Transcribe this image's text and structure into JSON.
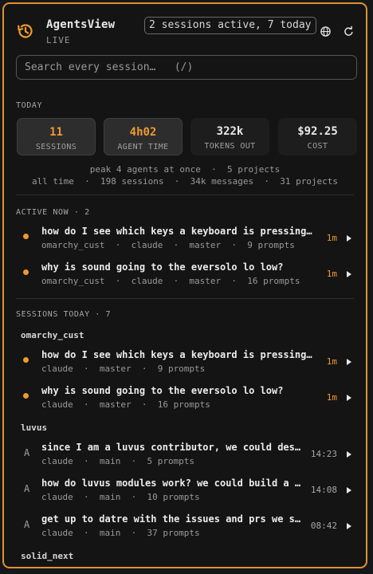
{
  "header": {
    "title": "AgentsView",
    "status": "LIVE",
    "sessions_pill": "2 sessions active, 7 today"
  },
  "search": {
    "placeholder": "Search every session…   (/)"
  },
  "today": {
    "label": "TODAY",
    "stats": [
      {
        "value": "11",
        "label": "SESSIONS"
      },
      {
        "value": "4h02",
        "label": "AGENT TIME"
      },
      {
        "value": "322k",
        "label": "TOKENS OUT"
      },
      {
        "value": "$92.25",
        "label": "COST"
      }
    ],
    "summary_line1": "peak 4 agents at once  ·  5 projects",
    "summary_line2": "all time  ·  198 sessions  ·  34k messages  ·  31 projects"
  },
  "active": {
    "label": "ACTIVE NOW  ·  2",
    "items": [
      {
        "title": "how do I see which keys a keyboard is pressing in real time?",
        "meta": "omarchy_cust  ·  claude  ·  master  ·  9 prompts",
        "time": "1m"
      },
      {
        "title": "why is sound going to the eversolo lo low?",
        "meta": "omarchy_cust  ·  claude  ·  master  ·  16 prompts",
        "time": "1m"
      }
    ]
  },
  "sessions_today": {
    "label": "SESSIONS TODAY  ·  7",
    "groups": [
      {
        "name": "omarchy_cust",
        "items": [
          {
            "title": "how do I see which keys a keyboard is pressing in real time?",
            "meta": "claude  ·  master  ·  9 prompts",
            "time": "1m"
          },
          {
            "title": "why is sound going to the eversolo lo low?",
            "meta": "claude  ·  master  ·  16 prompts",
            "time": "1m"
          }
        ]
      },
      {
        "name": "luvus",
        "items": [
          {
            "marker": "A",
            "title": "since I am a luvus contributor, we could design a new feature",
            "meta": "claude  ·  main  ·  5 prompts",
            "time": "14:23"
          },
          {
            "marker": "A",
            "title": "how do luvus modules work? we could build a luvus module",
            "meta": "claude  ·  main  ·  10 prompts",
            "time": "14:08"
          },
          {
            "marker": "A",
            "title": "get up to datre with the issues and prs we submitted",
            "meta": "claude  ·  main  ·  37 prompts",
            "time": "08:42"
          }
        ]
      },
      {
        "name": "solid_next",
        "items": []
      }
    ]
  },
  "colors": {
    "accent": "#ee9a30",
    "border": "#e0922e",
    "background": "#141414"
  }
}
